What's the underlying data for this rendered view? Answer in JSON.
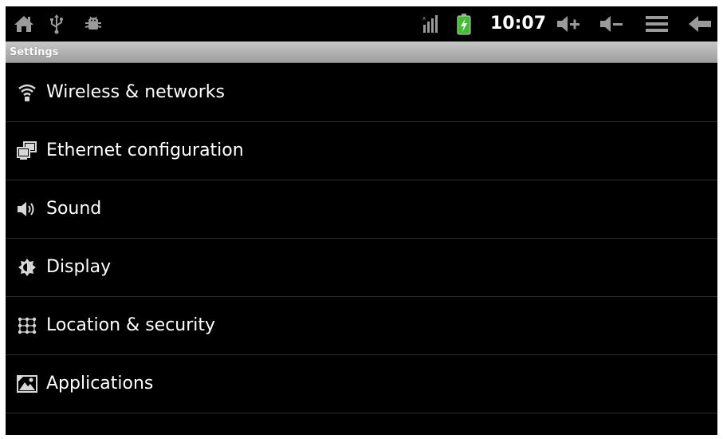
{
  "status_bar": {
    "time": "10:07",
    "left_icons": [
      "home-icon",
      "usb-icon",
      "android-debug-icon"
    ],
    "right_icons": [
      "signal-icon",
      "battery-charging-icon",
      "volume-up-icon",
      "volume-down-icon",
      "menu-icon",
      "back-icon"
    ],
    "battery_color": "#3fbf2f"
  },
  "title_bar": {
    "title": "Settings"
  },
  "settings": {
    "items": [
      {
        "label": "Wireless & networks",
        "icon": "wifi-icon"
      },
      {
        "label": "Ethernet configuration",
        "icon": "ethernet-icon"
      },
      {
        "label": "Sound",
        "icon": "speaker-icon"
      },
      {
        "label": "Display",
        "icon": "brightness-icon"
      },
      {
        "label": "Location & security",
        "icon": "location-grid-icon"
      },
      {
        "label": "Applications",
        "icon": "applications-icon"
      }
    ]
  }
}
